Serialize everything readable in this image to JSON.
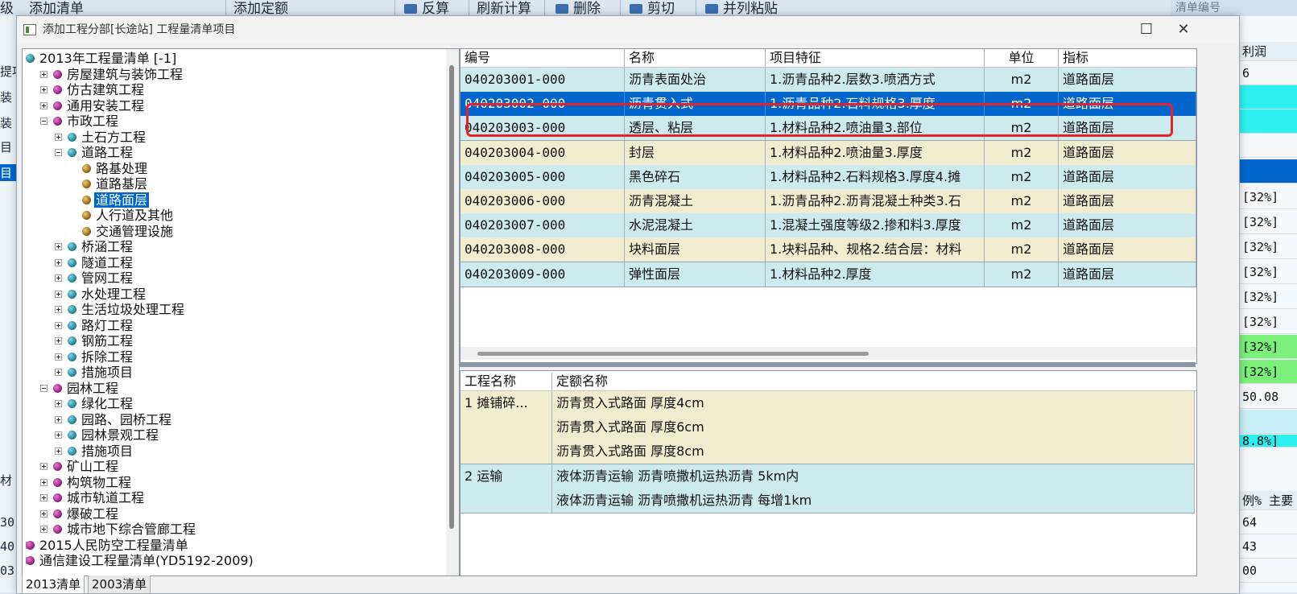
{
  "background": {
    "toolbar": [
      "级",
      "添加清单",
      "添加定额",
      "反算",
      "刷新计算",
      "删除",
      "剪切",
      "并列粘贴"
    ],
    "search_hint": "清单编号",
    "left_fragments": [
      "提项",
      "装",
      "装",
      "目",
      "目"
    ],
    "right_header": "利润",
    "right_values": [
      "6",
      "",
      "",
      "",
      "",
      "[32%]",
      "[32%]",
      "[32%]",
      "[32%]",
      "[32%]",
      "[32%]",
      "[32%]",
      "[32%]",
      "50.08",
      "",
      "8.8%]"
    ],
    "right_bottom_header": [
      "例%",
      "主要"
    ],
    "right_bottom_values": [
      "64",
      "43",
      "00"
    ],
    "left_bottom_values": [
      "30",
      "40",
      "03"
    ],
    "left_label_material": "材"
  },
  "dialog": {
    "title": "添加工程分部[长途站] 工程量清单项目",
    "minimize": "",
    "maximize": "☐",
    "close": "✕"
  },
  "tree": {
    "items": [
      {
        "label": "2013年工程量清单 [-1]",
        "level": 0,
        "expander": "none",
        "icon": "teal"
      },
      {
        "label": "房屋建筑与装饰工程",
        "level": 1,
        "expander": "plus",
        "icon": "purple"
      },
      {
        "label": "仿古建筑工程",
        "level": 1,
        "expander": "plus",
        "icon": "purple"
      },
      {
        "label": "通用安装工程",
        "level": 1,
        "expander": "plus",
        "icon": "purple"
      },
      {
        "label": "市政工程",
        "level": 1,
        "expander": "minus",
        "icon": "purple"
      },
      {
        "label": "土石方工程",
        "level": 2,
        "expander": "plus",
        "icon": "teal"
      },
      {
        "label": "道路工程",
        "level": 2,
        "expander": "minus",
        "icon": "teal"
      },
      {
        "label": "路基处理",
        "level": 3,
        "expander": "none",
        "icon": "gold"
      },
      {
        "label": "道路基层",
        "level": 3,
        "expander": "none",
        "icon": "gold"
      },
      {
        "label": "道路面层",
        "level": 3,
        "expander": "none",
        "icon": "gold",
        "selected": true
      },
      {
        "label": "人行道及其他",
        "level": 3,
        "expander": "none",
        "icon": "gold"
      },
      {
        "label": "交通管理设施",
        "level": 3,
        "expander": "none",
        "icon": "gold"
      },
      {
        "label": "桥涵工程",
        "level": 2,
        "expander": "plus",
        "icon": "teal"
      },
      {
        "label": "隧道工程",
        "level": 2,
        "expander": "plus",
        "icon": "teal"
      },
      {
        "label": "管网工程",
        "level": 2,
        "expander": "plus",
        "icon": "teal"
      },
      {
        "label": "水处理工程",
        "level": 2,
        "expander": "plus",
        "icon": "teal"
      },
      {
        "label": "生活垃圾处理工程",
        "level": 2,
        "expander": "plus",
        "icon": "teal"
      },
      {
        "label": "路灯工程",
        "level": 2,
        "expander": "plus",
        "icon": "teal"
      },
      {
        "label": "钢筋工程",
        "level": 2,
        "expander": "plus",
        "icon": "teal"
      },
      {
        "label": "拆除工程",
        "level": 2,
        "expander": "plus",
        "icon": "teal"
      },
      {
        "label": "措施项目",
        "level": 2,
        "expander": "plus",
        "icon": "teal"
      },
      {
        "label": "园林工程",
        "level": 1,
        "expander": "minus",
        "icon": "purple"
      },
      {
        "label": "绿化工程",
        "level": 2,
        "expander": "plus",
        "icon": "teal"
      },
      {
        "label": "园路、园桥工程",
        "level": 2,
        "expander": "plus",
        "icon": "teal"
      },
      {
        "label": "园林景观工程",
        "level": 2,
        "expander": "plus",
        "icon": "teal"
      },
      {
        "label": "措施项目",
        "level": 2,
        "expander": "plus",
        "icon": "teal"
      },
      {
        "label": "矿山工程",
        "level": 1,
        "expander": "plus",
        "icon": "purple"
      },
      {
        "label": "构筑物工程",
        "level": 1,
        "expander": "plus",
        "icon": "purple"
      },
      {
        "label": "城市轨道工程",
        "level": 1,
        "expander": "plus",
        "icon": "purple"
      },
      {
        "label": "爆破工程",
        "level": 1,
        "expander": "plus",
        "icon": "purple"
      },
      {
        "label": "城市地下综合管廊工程",
        "level": 1,
        "expander": "plus",
        "icon": "purple"
      },
      {
        "label": "2015人民防空工程量清单",
        "level": 0,
        "expander": "plus",
        "icon": "purple"
      },
      {
        "label": "通信建设工程量清单(YD5192-2009)",
        "level": 0,
        "expander": "plus",
        "icon": "purple"
      }
    ],
    "tabs": [
      "2013清单",
      "2003清单"
    ]
  },
  "items_grid": {
    "headers": [
      "编号",
      "名称",
      "项目特征",
      "单位",
      "指标"
    ],
    "rows": [
      {
        "code": "040203001-000",
        "name": "沥青表面处治",
        "features": "1.沥青品种2.层数3.喷洒方式",
        "unit": "m2",
        "index": "道路面层"
      },
      {
        "code": "040203002-000",
        "name": "沥青贯入式",
        "features": "1.沥青品种2.石料规格3.厚度",
        "unit": "m2",
        "index": "道路面层",
        "selected": true
      },
      {
        "code": "040203003-000",
        "name": "透层、粘层",
        "features": "1.材料品种2.喷油量3.部位",
        "unit": "m2",
        "index": "道路面层"
      },
      {
        "code": "040203004-000",
        "name": "封层",
        "features": "1.材料品种2.喷油量3.厚度",
        "unit": "m2",
        "index": "道路面层"
      },
      {
        "code": "040203005-000",
        "name": "黑色碎石",
        "features": "1.材料品种2.石料规格3.厚度4.摊",
        "unit": "m2",
        "index": "道路面层"
      },
      {
        "code": "040203006-000",
        "name": "沥青混凝土",
        "features": "1.沥青品种2.沥青混凝土种类3.石",
        "unit": "m2",
        "index": "道路面层"
      },
      {
        "code": "040203007-000",
        "name": "水泥混凝土",
        "features": "1.混凝土强度等级2.掺和料3.厚度",
        "unit": "m2",
        "index": "道路面层"
      },
      {
        "code": "040203008-000",
        "name": "块料面层",
        "features": "1.块料品种、规格2.结合层：材料",
        "unit": "m2",
        "index": "道路面层"
      },
      {
        "code": "040203009-000",
        "name": "弹性面层",
        "features": "1.材料品种2.厚度",
        "unit": "m2",
        "index": "道路面层"
      }
    ]
  },
  "quota_grid": {
    "headers": [
      "工程名称",
      "定额名称"
    ],
    "rows": [
      {
        "project": "1 摊铺碎...",
        "quota": "沥青贯入式路面 厚度4cm"
      },
      {
        "project": "",
        "quota": "沥青贯入式路面 厚度6cm"
      },
      {
        "project": "",
        "quota": "沥青贯入式路面 厚度8cm"
      },
      {
        "project": "2 运输",
        "quota": "液体沥青运输 沥青喷撒机运热沥青 5km内"
      },
      {
        "project": "",
        "quota": "液体沥青运输 沥青喷撒机运热沥青 每增1km"
      }
    ]
  }
}
